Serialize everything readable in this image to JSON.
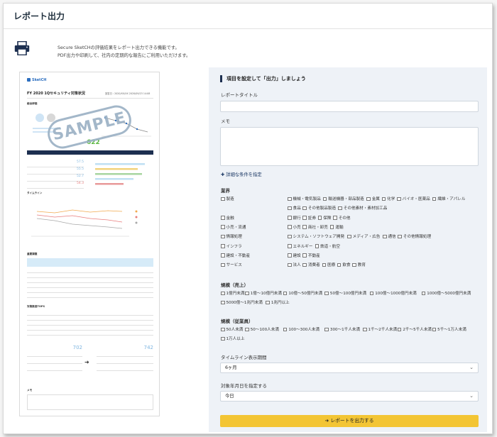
{
  "page": {
    "title": "レポート出力"
  },
  "intro": {
    "line1": "Secure SketCHの評価結果をレポート出力できる機能です。",
    "line2": "PDF出力や印刷して、社内の定期的な報告にご利用いただけます。"
  },
  "preview": {
    "logo": "SketCH",
    "title": "FY 2020 1Qセキュリティ対策状況",
    "meta": "回答日 : 2020/XX/XX   2020/09/23 14:08",
    "stamp": "SAMPLE",
    "score": "622",
    "section_score": "総合評価",
    "section_timeline": "タイムライン",
    "section_issues": "重要課題",
    "section_actions": "対策推進TOPS",
    "section_memo": "メモ",
    "kpi_left": [
      "57.5",
      "55.5",
      "52.7",
      "54.3"
    ],
    "kpi_right": [
      "702",
      "742"
    ]
  },
  "form": {
    "heading": "項目を設定して「出力」しましょう",
    "report_title_label": "レポートタイトル",
    "report_title_value": "",
    "memo_label": "メモ",
    "memo_value": "",
    "detail_link": "詳細な条件を指定",
    "industry_label": "業界",
    "industry_rows": [
      {
        "cat": "製造",
        "opts": [
          "機械・電気製品",
          "輸送機器・部品製造",
          "金属",
          "化学",
          "バイオ・医薬品",
          "繊維・アパレル"
        ]
      },
      {
        "cat": "",
        "opts": [
          "食品",
          "その他製品製造",
          "その他素材・素材加工品"
        ]
      },
      {
        "cat": "金融",
        "opts": [
          "銀行",
          "証券",
          "保険",
          "その他"
        ]
      },
      {
        "cat": "小売・流通",
        "opts": [
          "小売",
          "商社・卸売",
          "運輸"
        ]
      },
      {
        "cat": "情報処理",
        "opts": [
          "システム・ソフトウェア開発",
          "メディア・広告",
          "通信",
          "その他情報処理"
        ]
      },
      {
        "cat": "インフラ",
        "opts": [
          "エネルギー",
          "鉄道・航空"
        ]
      },
      {
        "cat": "建設・不動産",
        "opts": [
          "建設",
          "不動産"
        ]
      },
      {
        "cat": "サービス",
        "opts": [
          "法人",
          "消費者",
          "医療",
          "飲食",
          "教育"
        ]
      }
    ],
    "sales_label": "規模（売上）",
    "sales_opts": [
      "1億円未満",
      "1億〜10億円未満",
      "10億〜50億円未満",
      "50億〜100億円未満",
      "100億〜1000億円未満",
      "1000億〜5000億円未満"
    ],
    "sales_opts2": [
      "5000億〜1兆円未満",
      "1兆円以上"
    ],
    "staff_label": "規模（従業員）",
    "staff_opts": [
      "50人未満",
      "50〜100人未満",
      "100〜300人未満",
      "300〜1千人未満",
      "1千〜2千人未満",
      "2千〜5千人未満",
      "5千〜1万人未満"
    ],
    "staff_opts2": [
      "1万人以上"
    ],
    "timeline_label": "タイムライン表示期間",
    "timeline_value": "6ヶ月",
    "target_label": "対象年月日を指定する",
    "target_value": "今日",
    "submit_label": "レポートを出力する"
  },
  "colors": {
    "navy": "#1d2f50",
    "accent_yellow": "#f3c534",
    "form_bg": "#eef2f7",
    "link_blue": "#1d3a66"
  }
}
